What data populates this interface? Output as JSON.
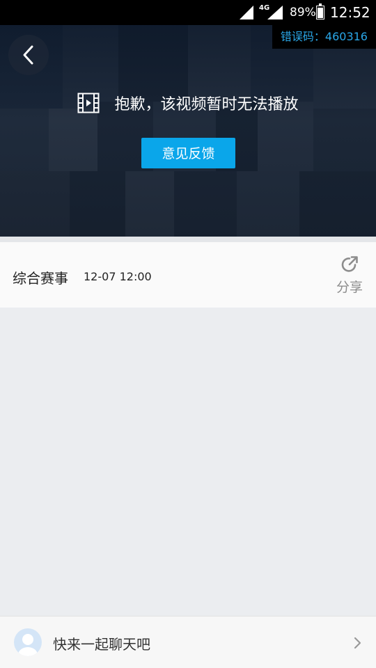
{
  "status_bar": {
    "network": "4G",
    "battery": "89%",
    "battery_level": 0.89,
    "time": "12:52"
  },
  "player": {
    "error_code": "错误码：460316",
    "error_message": "抱歉，该视频暂时无法播放",
    "feedback_label": "意见反馈",
    "icons": [
      "back-arrow-icon",
      "video-film-icon"
    ]
  },
  "info": {
    "title": "综合赛事",
    "time": "12-07 12:00",
    "share_label": "分享"
  },
  "chat": {
    "prompt": "快来一起聊天吧"
  },
  "colors": {
    "accent": "#0aa6ea",
    "error_code_text": "#2aa7e8",
    "background": "#ebedf0"
  }
}
